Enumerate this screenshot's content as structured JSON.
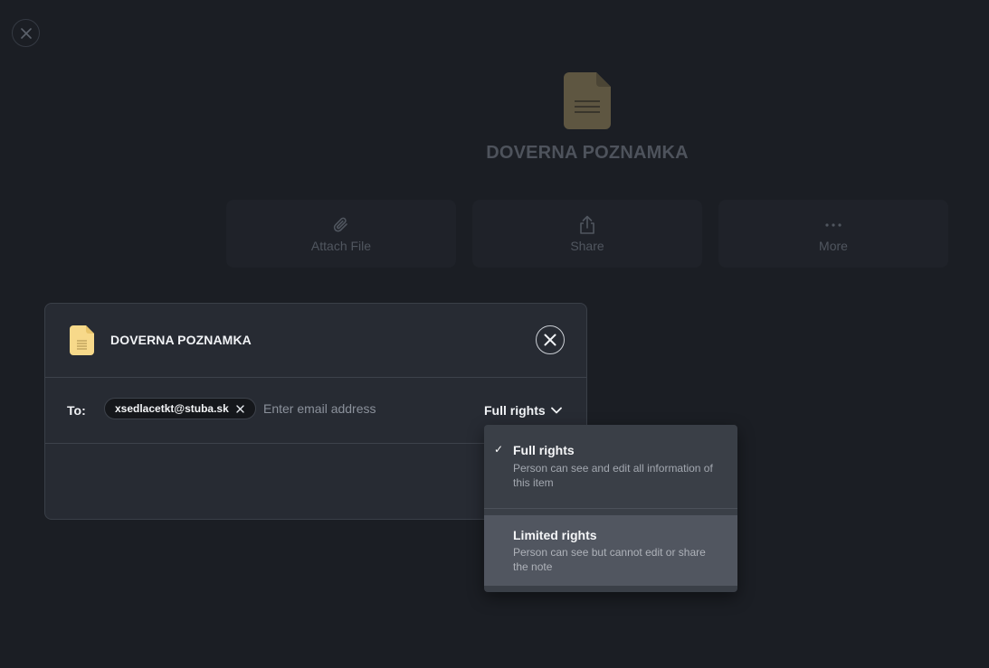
{
  "background": {
    "title": "DOVERNA POZNAMKA",
    "actions": [
      {
        "label": "Attach File",
        "icon": "paperclip-icon"
      },
      {
        "label": "Share",
        "icon": "share-icon"
      },
      {
        "label": "More",
        "icon": "more-dots-icon"
      }
    ]
  },
  "modal": {
    "title": "DOVERNA POZNAMKA",
    "to_label": "To:",
    "recipients": [
      {
        "email": "xsedlacetkt@stuba.sk"
      }
    ],
    "email_placeholder": "Enter email address",
    "rights_selected": "Full rights"
  },
  "dropdown": {
    "options": [
      {
        "label": "Full rights",
        "description": "Person can see and edit all information of this item",
        "selected": true,
        "check": "✓"
      },
      {
        "label": "Limited rights",
        "description": "Person can see but cannot edit or share the note",
        "selected": false,
        "highlighted": true
      }
    ]
  },
  "colors": {
    "page_background": "#1b1e24",
    "modal_background": "#272b33",
    "dropdown_background": "#3a3f47",
    "dropdown_hover": "#515660",
    "note_icon_yellow": "#f7d98a"
  }
}
